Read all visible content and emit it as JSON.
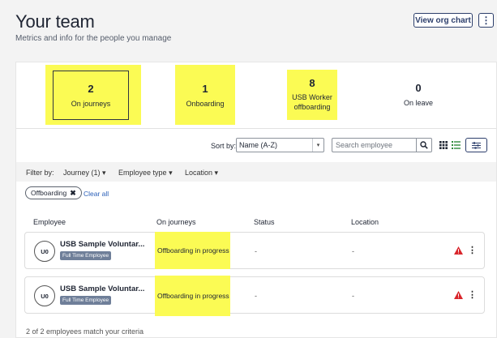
{
  "header": {
    "title": "Your team",
    "subtitle": "Metrics and info for the people you manage",
    "org_chart_label": "View org chart",
    "more_label": "⋮"
  },
  "stats": [
    {
      "value": "2",
      "label": "On journeys",
      "selected": true
    },
    {
      "value": "1",
      "label": "Onboarding"
    },
    {
      "value": "8",
      "label_line1": "USB Worker",
      "label_line2": "offboarding"
    },
    {
      "value": "0",
      "label": "On leave"
    }
  ],
  "toolbar": {
    "sort_label": "Sort by:",
    "sort_value": "Name (A-Z)",
    "search_placeholder": "Search employee"
  },
  "filters": {
    "label": "Filter by:",
    "journey": "Journey (1)",
    "employee_type": "Employee type",
    "location": "Location",
    "active_chip": "Offboarding",
    "clear_all": "Clear all"
  },
  "table": {
    "columns": [
      "Employee",
      "On journeys",
      "Status",
      "Location"
    ],
    "rows": [
      {
        "initials": "U0",
        "name": "USB Sample Voluntar...",
        "type": "Full Time Employee",
        "journey": "Offboarding in progress",
        "status": "-",
        "location": "-"
      },
      {
        "initials": "U0",
        "name": "USB Sample Voluntar...",
        "type": "Full Time Employee",
        "journey": "Offboarding in progress",
        "status": "-",
        "location": "-"
      }
    ],
    "footer": "2 of 2 employees match your criteria"
  },
  "colors": {
    "highlight": "#fbfb54",
    "accent": "#2c3e6b",
    "warning": "#d9262c",
    "badge": "#6f7f99",
    "link": "#2a5fb8",
    "list_view_active": "#2f8a3b"
  }
}
